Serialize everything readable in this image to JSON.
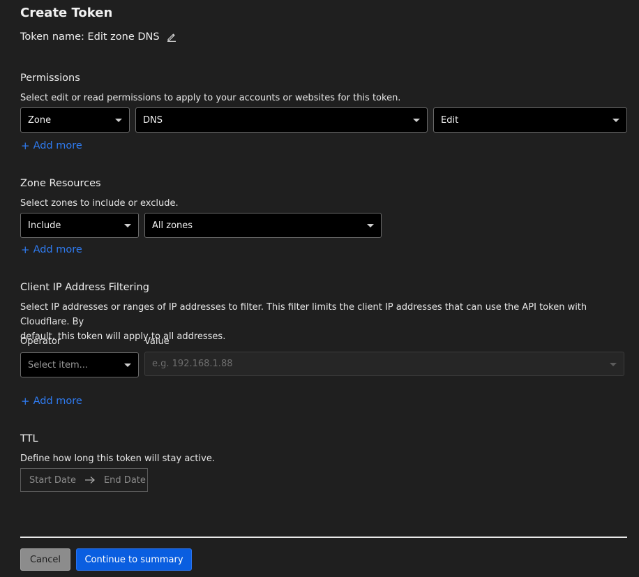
{
  "header": {
    "title": "Create Token",
    "token_name_label": "Token name: Edit zone DNS"
  },
  "permissions": {
    "title": "Permissions",
    "description": "Select edit or read permissions to apply to your accounts or websites for this token.",
    "scope_value": "Zone",
    "resource_value": "DNS",
    "access_value": "Edit",
    "add_more": "Add more"
  },
  "zone_resources": {
    "title": "Zone Resources",
    "description": "Select zones to include or exclude.",
    "mode_value": "Include",
    "zones_value": "All zones",
    "add_more": "Add more"
  },
  "ip_filtering": {
    "title": "Client IP Address Filtering",
    "description_line1": "Select IP addresses or ranges of IP addresses to filter. This filter limits the client IP addresses that can use the API token with Cloudflare. By",
    "description_line2": "default, this token will apply to all addresses.",
    "operator_label": "Operator",
    "value_label": "Value",
    "operator_placeholder": "Select item...",
    "value_placeholder": "e.g. 192.168.1.88",
    "add_more": "Add more"
  },
  "ttl": {
    "title": "TTL",
    "description": "Define how long this token will stay active.",
    "start_placeholder": "Start Date",
    "end_placeholder": "End Date"
  },
  "footer": {
    "cancel_label": "Cancel",
    "continue_label": "Continue to summary"
  },
  "icons": {
    "edit": "pencil-icon",
    "caret": "caret-down-icon",
    "add": "plus-icon",
    "range_arrow": "arrow-right-icon"
  },
  "colors": {
    "background": "#1f1f1f",
    "link": "#2f7bf0",
    "primary_button": "#0a5ee0",
    "cancel_button": "#8c8c8c",
    "select_background": "#000000"
  }
}
